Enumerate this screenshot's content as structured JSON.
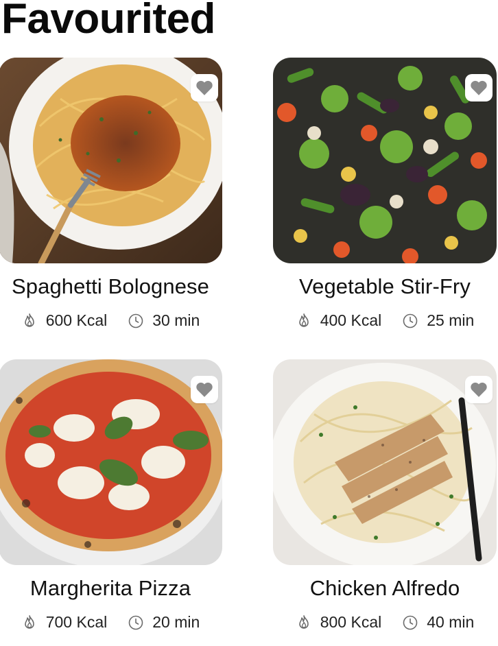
{
  "header": {
    "title": "Favourited"
  },
  "icons": {
    "calories": "flame-icon",
    "time": "clock-icon",
    "favorite": "heart-icon"
  },
  "colors": {
    "heart": "#8a8a8a",
    "meta_icon": "#6b6b6b"
  },
  "recipes": [
    {
      "name": "Spaghetti Bolognese",
      "calories": "600 Kcal",
      "time": "30 min",
      "favorited": true
    },
    {
      "name": "Vegetable Stir-Fry",
      "calories": "400 Kcal",
      "time": "25 min",
      "favorited": true
    },
    {
      "name": "Margherita Pizza",
      "calories": "700 Kcal",
      "time": "20 min",
      "favorited": true
    },
    {
      "name": "Chicken Alfredo",
      "calories": "800 Kcal",
      "time": "40 min",
      "favorited": true
    }
  ]
}
